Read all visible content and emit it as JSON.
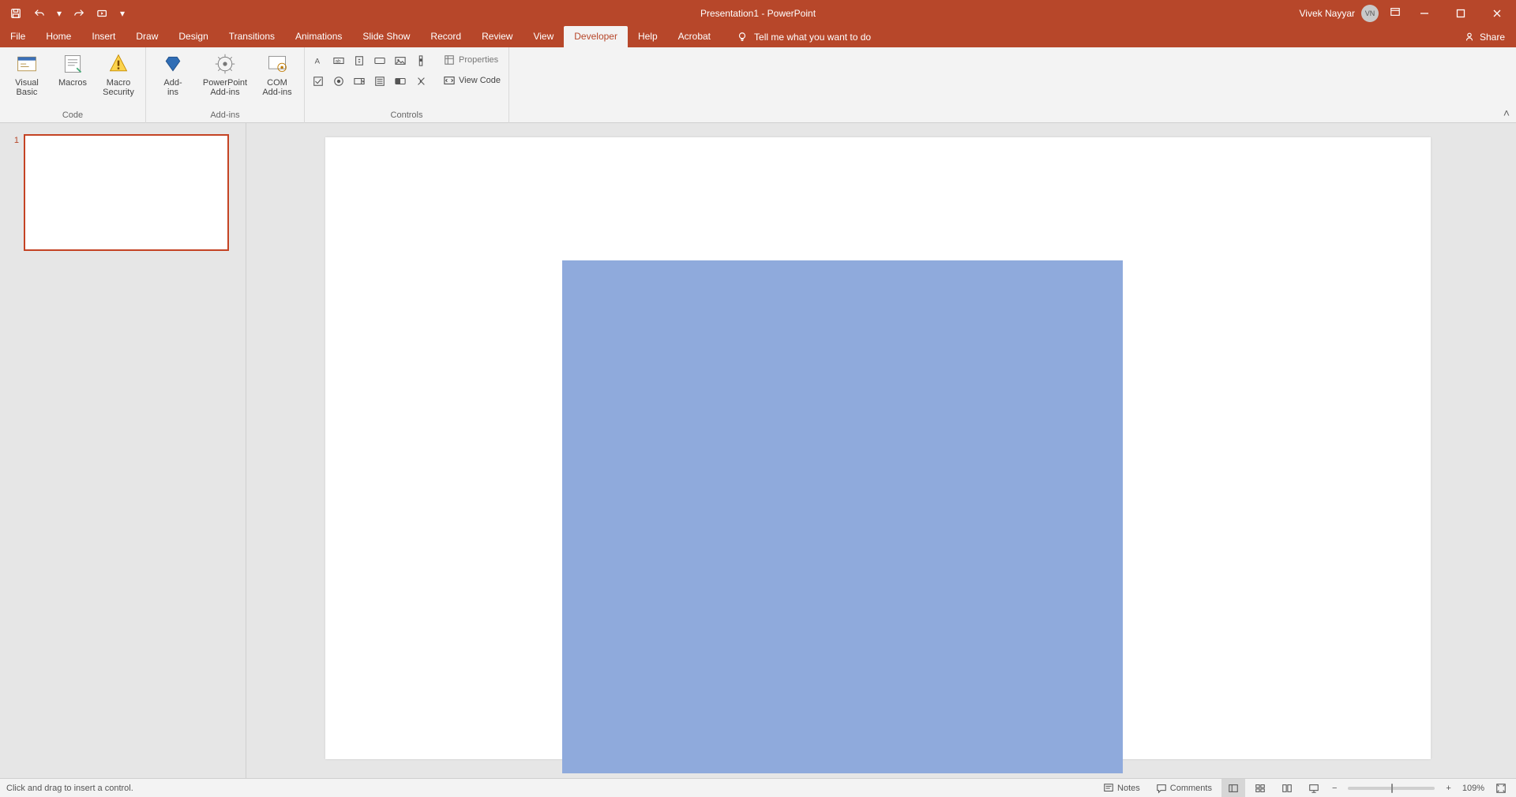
{
  "app": {
    "title": "Presentation1  -  PowerPoint"
  },
  "user": {
    "name": "Vivek Nayyar",
    "initials": "VN"
  },
  "qat": {
    "customize": "▾"
  },
  "tabs": {
    "file": "File",
    "items": [
      "Home",
      "Insert",
      "Draw",
      "Design",
      "Transitions",
      "Animations",
      "Slide Show",
      "Record",
      "Review",
      "View",
      "Developer",
      "Help",
      "Acrobat"
    ],
    "active": "Developer",
    "tellme": "Tell me what you want to do",
    "share": "Share"
  },
  "ribbon": {
    "code": {
      "visual_basic": "Visual\nBasic",
      "macros": "Macros",
      "macro_security": "Macro\nSecurity",
      "label": "Code"
    },
    "addins": {
      "addins": "Add-\nins",
      "ppt_addins": "PowerPoint\nAdd-ins",
      "com_addins": "COM\nAdd-ins",
      "label": "Add-ins"
    },
    "controls": {
      "properties": "Properties",
      "view_code": "View Code",
      "label": "Controls"
    }
  },
  "thumb": {
    "num": "1"
  },
  "status": {
    "msg": "Click and drag to insert a control.",
    "notes": "Notes",
    "comments": "Comments",
    "zoom": "109%"
  }
}
